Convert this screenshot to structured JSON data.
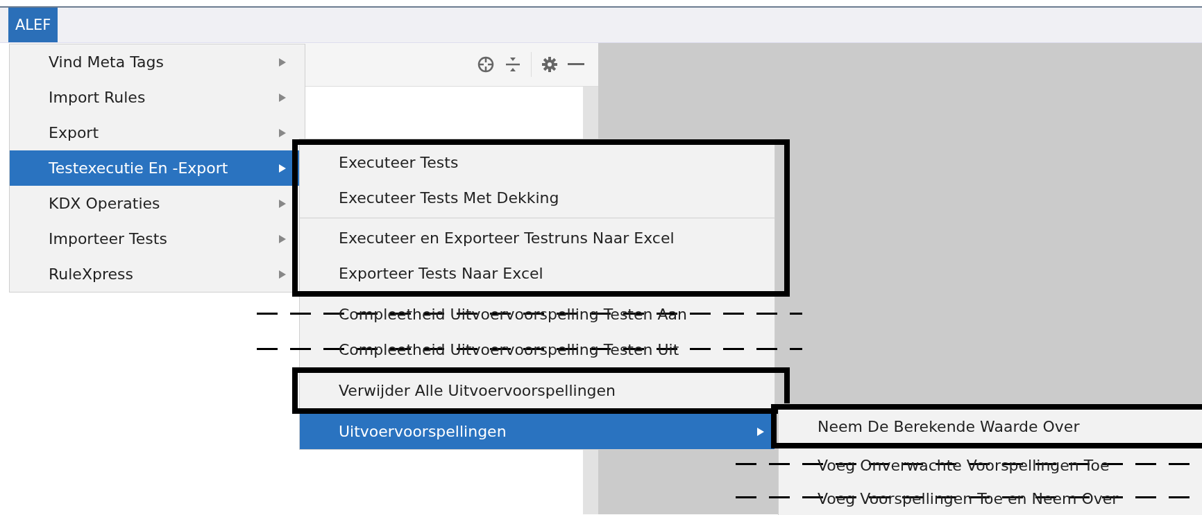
{
  "menubar": [
    {
      "label": "ALEF",
      "selected": true
    }
  ],
  "menu": {
    "sections": [
      {
        "items": [
          {
            "label": "Vind Meta Tags",
            "selected": false,
            "submenu_arrow": true
          },
          {
            "label": "Import Rules",
            "selected": false,
            "submenu_arrow": true
          },
          {
            "label": "Export",
            "selected": false,
            "submenu_arrow": true
          },
          {
            "label": "Testexecutie En -Export",
            "selected": true,
            "submenu_arrow": true
          },
          {
            "label": "KDX Operaties",
            "selected": false,
            "submenu_arrow": true
          },
          {
            "label": "Importeer Tests",
            "selected": false,
            "submenu_arrow": true
          },
          {
            "label": "RuleXpress",
            "selected": false,
            "submenu_arrow": true
          }
        ]
      }
    ]
  },
  "submenu": {
    "sections": [
      {
        "kind": "box",
        "items": [
          {
            "label": "Executeer Tests",
            "selected": false,
            "submenu_arrow": false,
            "separator_before": false
          },
          {
            "label": "Executeer Tests Met Dekking",
            "selected": false,
            "submenu_arrow": false,
            "separator_before": false
          },
          {
            "label": "Executeer en Exporteer Testruns Naar Excel",
            "selected": false,
            "submenu_arrow": false,
            "separator_before": true
          },
          {
            "label": "Exporteer Tests Naar Excel",
            "selected": false,
            "submenu_arrow": false,
            "separator_before": false
          }
        ]
      },
      {
        "kind": "strike",
        "items": [
          {
            "label": "Compleetheid Uitvoervoorspelling Testen Aan",
            "selected": false,
            "submenu_arrow": false,
            "separator_before": false
          },
          {
            "label": "Compleetheid Uitvoervoorspelling Testen Uit",
            "selected": false,
            "submenu_arrow": false,
            "separator_before": false
          }
        ]
      },
      {
        "kind": "box",
        "items": [
          {
            "label": "Verwijder Alle Uitvoervoorspellingen",
            "selected": false,
            "submenu_arrow": false,
            "separator_before": false
          }
        ]
      },
      {
        "kind": "plain",
        "items": [
          {
            "label": "Uitvoervoorspellingen",
            "selected": true,
            "submenu_arrow": true,
            "separator_before": false
          }
        ]
      }
    ]
  },
  "submenu_2": {
    "sections": [
      {
        "kind": "box",
        "items": [
          {
            "label": "Neem De Berekende Waarde Over",
            "selected": false,
            "submenu_arrow": false
          }
        ]
      },
      {
        "kind": "strike",
        "items": [
          {
            "label": "Voeg Onverwachte Voorspellingen Toe",
            "selected": false,
            "submenu_arrow": false
          },
          {
            "label": "Voeg Voorspellingen Toe en Neem Over",
            "selected": false,
            "submenu_arrow": false
          }
        ]
      }
    ]
  }
}
